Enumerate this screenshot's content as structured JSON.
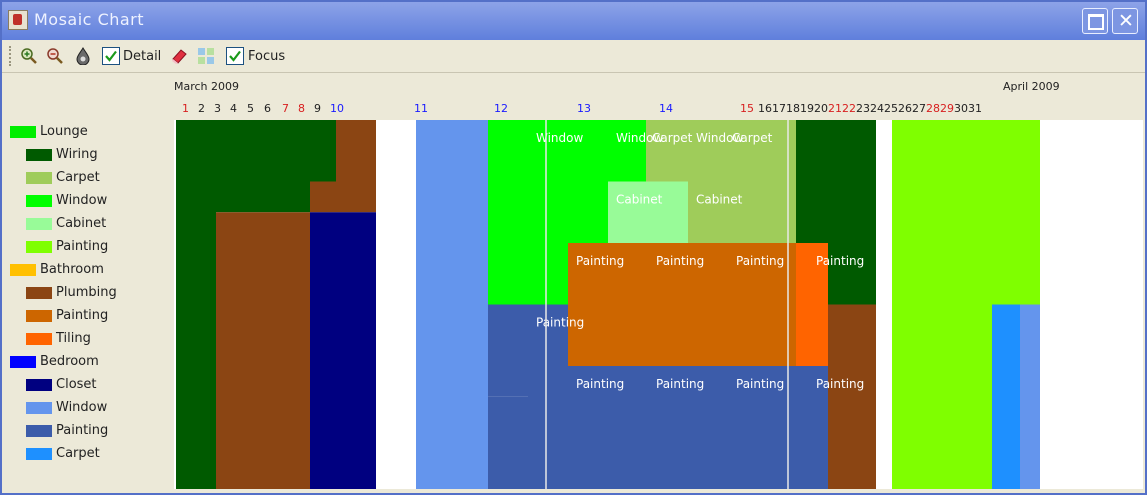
{
  "window": {
    "title": "Mosaic Chart"
  },
  "toolbar": {
    "detail_label": "Detail",
    "detail_checked": true,
    "focus_label": "Focus",
    "focus_checked": true
  },
  "legend": [
    {
      "label": "Lounge",
      "color": "#00ee00",
      "indent": false
    },
    {
      "label": "Wiring",
      "color": "#005a00",
      "indent": true
    },
    {
      "label": "Carpet",
      "color": "#9fcc5a",
      "indent": true
    },
    {
      "label": "Window",
      "color": "#00ff00",
      "indent": true
    },
    {
      "label": "Cabinet",
      "color": "#98fb98",
      "indent": true
    },
    {
      "label": "Painting",
      "color": "#7fff00",
      "indent": true
    },
    {
      "label": "Bathroom",
      "color": "#ffc000",
      "indent": false
    },
    {
      "label": "Plumbing",
      "color": "#8b4513",
      "indent": true
    },
    {
      "label": "Painting",
      "color": "#cd6600",
      "indent": true
    },
    {
      "label": "Tiling",
      "color": "#ff6400",
      "indent": true
    },
    {
      "label": "Bedroom",
      "color": "#0000ff",
      "indent": false
    },
    {
      "label": "Closet",
      "color": "#000080",
      "indent": true
    },
    {
      "label": "Window",
      "color": "#6495ed",
      "indent": true
    },
    {
      "label": "Painting",
      "color": "#3c5caa",
      "indent": true
    },
    {
      "label": "Carpet",
      "color": "#1e90ff",
      "indent": true
    }
  ],
  "timeline": {
    "month1": "March 2009",
    "month2": "April 2009",
    "days": [
      {
        "d": "1",
        "c": "#d82020"
      },
      {
        "d": "2",
        "c": "#222222"
      },
      {
        "d": "3",
        "c": "#222222"
      },
      {
        "d": "4",
        "c": "#222222"
      },
      {
        "d": "5",
        "c": "#222222"
      },
      {
        "d": "6",
        "c": "#222222"
      },
      {
        "d": "7",
        "c": "#d82020"
      },
      {
        "d": "8",
        "c": "#d82020"
      },
      {
        "d": "9",
        "c": "#222222"
      },
      {
        "d": "10",
        "c": "#1a1aff"
      },
      {
        "d": "11",
        "c": "#1a1aff"
      },
      {
        "d": "12",
        "c": "#1a1aff"
      },
      {
        "d": "13",
        "c": "#1a1aff"
      },
      {
        "d": "14",
        "c": "#1a1aff"
      },
      {
        "d": "15",
        "c": "#d82020"
      },
      {
        "d": "16",
        "c": "#222222"
      },
      {
        "d": "17",
        "c": "#222222"
      },
      {
        "d": "18",
        "c": "#222222"
      },
      {
        "d": "19",
        "c": "#222222"
      },
      {
        "d": "20",
        "c": "#222222"
      },
      {
        "d": "21",
        "c": "#d82020"
      },
      {
        "d": "22",
        "c": "#d82020"
      },
      {
        "d": "23",
        "c": "#222222"
      },
      {
        "d": "24",
        "c": "#222222"
      },
      {
        "d": "25",
        "c": "#222222"
      },
      {
        "d": "26",
        "c": "#222222"
      },
      {
        "d": "27",
        "c": "#222222"
      },
      {
        "d": "28",
        "c": "#d82020"
      },
      {
        "d": "29",
        "c": "#d82020"
      },
      {
        "d": "30",
        "c": "#222222"
      },
      {
        "d": "31",
        "c": "#222222"
      }
    ]
  },
  "mosaic": {
    "blocks": [
      {
        "day0": 0,
        "day1": 4,
        "row0": 0,
        "row1": 1,
        "color": "#005a00"
      },
      {
        "day0": 0,
        "day1": 1,
        "row0": 1,
        "row1": 6,
        "color": "#005a00"
      },
      {
        "day0": 1,
        "day1": 3.35,
        "row0": 1,
        "row1": 1.5,
        "color": "#005a00"
      },
      {
        "day0": 1,
        "day1": 3.35,
        "row0": 1.5,
        "row1": 6,
        "color": "#8b4513"
      },
      {
        "day0": 3.35,
        "day1": 4,
        "row0": 1,
        "row1": 1.5,
        "color": "#8b4513"
      },
      {
        "day0": 3.35,
        "day1": 4,
        "row0": 1.5,
        "row1": 6,
        "color": "#000080"
      },
      {
        "day0": 4,
        "day1": 5,
        "row0": 0,
        "row1": 1.5,
        "color": "#8b4513"
      },
      {
        "day0": 4,
        "day1": 5,
        "row0": 1.5,
        "row1": 6,
        "color": "#000080"
      },
      {
        "day0": 5,
        "day1": 6,
        "row0": 0,
        "row1": 6,
        "color": "#ffffff"
      },
      {
        "day0": 6,
        "day1": 7.8,
        "row0": 0,
        "row1": 6,
        "color": "#6495ed"
      },
      {
        "day0": 7.8,
        "day1": 8.8,
        "row0": 0,
        "row1": 3,
        "color": "#00ff00"
      },
      {
        "day0": 7.8,
        "day1": 8.8,
        "row0": 3,
        "row1": 4.5,
        "color": "#3c5caa"
      },
      {
        "day0": 7.8,
        "day1": 8.8,
        "row0": 4.5,
        "row1": 6,
        "color": "#3c5caa"
      },
      {
        "day0": 8.8,
        "day1": 11.75,
        "row0": 0,
        "row1": 1,
        "color": "#00ff00",
        "label": "Window"
      },
      {
        "day0": 11.75,
        "day1": 15.5,
        "row0": 0,
        "row1": 1,
        "color": "#9fcc5a",
        "label": "Carpet"
      },
      {
        "day0": 8.8,
        "day1": 10.8,
        "row0": 1,
        "row1": 2,
        "color": "#00ff00"
      },
      {
        "day0": 10.8,
        "day1": 12.8,
        "row0": 1,
        "row1": 2,
        "color": "#98fb98",
        "label": "Cabinet"
      },
      {
        "day0": 12.8,
        "day1": 15.5,
        "row0": 1,
        "row1": 2,
        "color": "#9fcc5a"
      },
      {
        "day0": 8.8,
        "day1": 9.8,
        "row0": 2,
        "row1": 3,
        "color": "#00ff00"
      },
      {
        "day0": 9.8,
        "day1": 15.5,
        "row0": 2,
        "row1": 4,
        "color": "#cd6600",
        "label": "Painting"
      },
      {
        "day0": 8.8,
        "day1": 9.8,
        "row0": 3,
        "row1": 4,
        "color": "#3c5caa",
        "label": "Painting"
      },
      {
        "day0": 8.8,
        "day1": 15.5,
        "row0": 4,
        "row1": 6,
        "color": "#3c5caa",
        "label": "Painting"
      },
      {
        "day0": 15.5,
        "day1": 16.3,
        "row0": 0,
        "row1": 2,
        "color": "#005a00"
      },
      {
        "day0": 15.5,
        "day1": 16.3,
        "row0": 2,
        "row1": 4,
        "color": "#ff6400"
      },
      {
        "day0": 15.5,
        "day1": 16.3,
        "row0": 4,
        "row1": 6,
        "color": "#3c5caa"
      },
      {
        "day0": 16.3,
        "day1": 17.5,
        "row0": 0,
        "row1": 2,
        "color": "#005a00"
      },
      {
        "day0": 16.3,
        "day1": 17.5,
        "row0": 2,
        "row1": 3,
        "color": "#005a00"
      },
      {
        "day0": 16.3,
        "day1": 17.5,
        "row0": 3,
        "row1": 6,
        "color": "#8b4513"
      },
      {
        "day0": 17.5,
        "day1": 17.9,
        "row0": 0,
        "row1": 6,
        "color": "#ffffff"
      },
      {
        "day0": 17.9,
        "day1": 20.4,
        "row0": 0,
        "row1": 6,
        "color": "#7fff00"
      },
      {
        "day0": 20.4,
        "day1": 20.75,
        "row0": 0,
        "row1": 3,
        "color": "#7fff00"
      },
      {
        "day0": 20.4,
        "day1": 20.75,
        "row0": 3,
        "row1": 6,
        "color": "#1e90ff"
      },
      {
        "day0": 20.75,
        "day1": 21.1,
        "row0": 0,
        "row1": 3,
        "color": "#7fff00"
      },
      {
        "day0": 20.75,
        "day1": 21.1,
        "row0": 3,
        "row1": 6,
        "color": "#1e90ff"
      },
      {
        "day0": 21.1,
        "day1": 21.6,
        "row0": 0,
        "row1": 3,
        "color": "#7fff00"
      },
      {
        "day0": 21.1,
        "day1": 21.6,
        "row0": 3,
        "row1": 6,
        "color": "#6495ed"
      }
    ],
    "labels": [
      {
        "text": "Window",
        "day": 8.9,
        "row": 0,
        "cols": 3
      },
      {
        "text": "Carpet",
        "day": 11.8,
        "row": 0,
        "cols": 2
      },
      {
        "text": "Cabinet",
        "day": 10.9,
        "row": 1,
        "cols": 2
      },
      {
        "text": "Painting",
        "day": 9.9,
        "row": 2,
        "cols": 4
      },
      {
        "text": "Painting",
        "day": 8.9,
        "row": 3,
        "cols": 1
      },
      {
        "text": "Painting",
        "day": 9.9,
        "row": 4,
        "cols": 4
      }
    ],
    "focus_lines": [
      9.25,
      15.3
    ]
  }
}
